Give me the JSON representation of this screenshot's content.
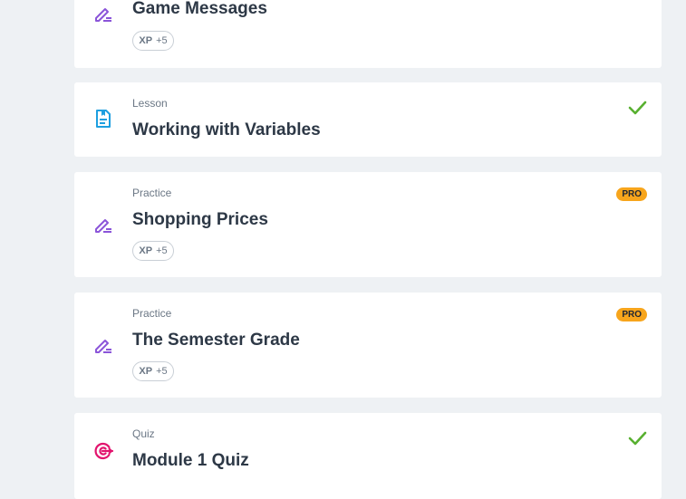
{
  "colors": {
    "practice_icon": "#8b55d9",
    "lesson_icon": "#1d9fe0",
    "quiz_icon": "#e2146e",
    "check": "#58b030",
    "pro_badge": "#f7a51c"
  },
  "items": [
    {
      "kind": "",
      "title": "Game Messages",
      "icon": "pencil-lines-icon",
      "xp_label": "XP",
      "xp_value": "+5"
    },
    {
      "kind": "Lesson",
      "title": "Working with Variables",
      "icon": "document-icon",
      "completed": true
    },
    {
      "kind": "Practice",
      "title": "Shopping Prices",
      "icon": "pencil-lines-icon",
      "xp_label": "XP",
      "xp_value": "+5",
      "badge": "PRO"
    },
    {
      "kind": "Practice",
      "title": "The Semester Grade",
      "icon": "pencil-lines-icon",
      "xp_label": "XP",
      "xp_value": "+5",
      "badge": "PRO"
    },
    {
      "kind": "Quiz",
      "title": "Module 1 Quiz",
      "icon": "target-icon",
      "completed": true
    }
  ]
}
